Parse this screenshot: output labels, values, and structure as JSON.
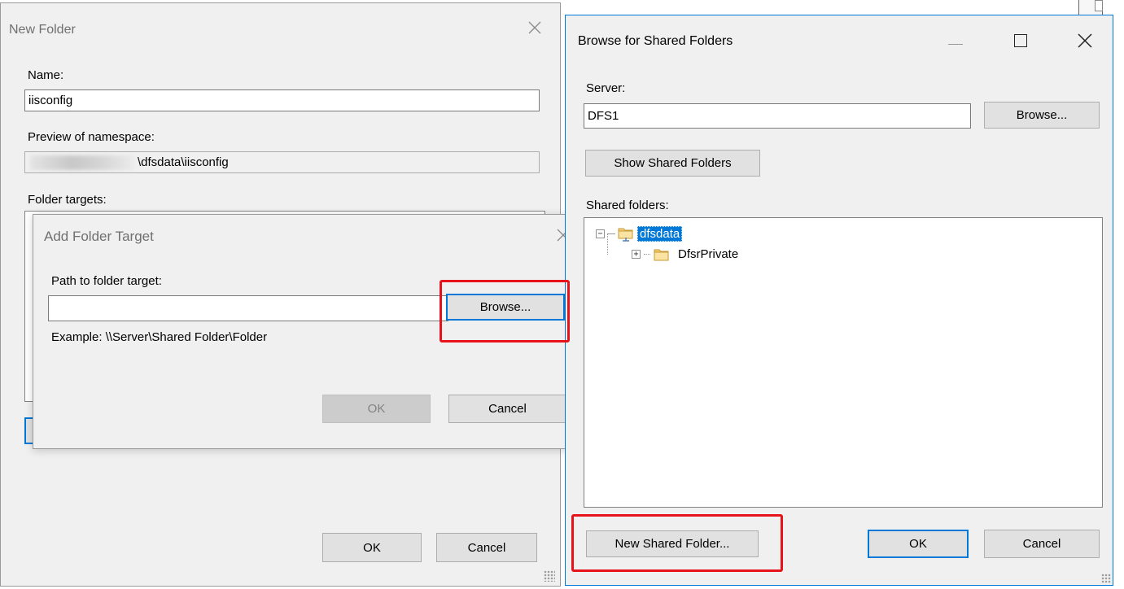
{
  "new_folder": {
    "title": "New Folder",
    "name_label": "Name:",
    "name_value": "iisconfig",
    "preview_label": "Preview of namespace:",
    "preview_value": "\\dfsdata\\iisconfig",
    "targets_label": "Folder targets:",
    "ok": "OK",
    "cancel": "Cancel"
  },
  "add_target": {
    "title": "Add Folder Target",
    "path_label": "Path to folder target:",
    "path_value": "",
    "browse": "Browse...",
    "example": "Example: \\\\Server\\Shared Folder\\Folder",
    "ok": "OK",
    "cancel": "Cancel"
  },
  "browse_shared": {
    "title": "Browse for Shared Folders",
    "server_label": "Server:",
    "server_value": "DFS1",
    "browse": "Browse...",
    "show_shared": "Show Shared Folders",
    "shared_label": "Shared folders:",
    "tree": [
      {
        "label": "dfsdata",
        "expander": "−",
        "selected": true
      },
      {
        "label": "DfsrPrivate",
        "expander": "+",
        "selected": false
      }
    ],
    "new_shared": "New Shared Folder...",
    "ok": "OK",
    "cancel": "Cancel"
  },
  "colors": {
    "highlight": "#e8121a",
    "accent": "#0078d7",
    "selection": "#0078d7"
  }
}
